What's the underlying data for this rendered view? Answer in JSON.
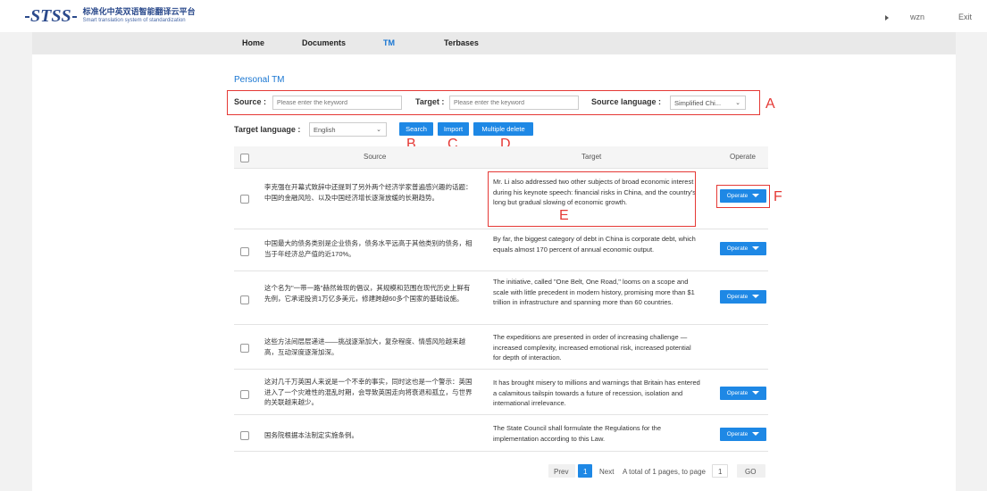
{
  "header": {
    "logo_mark": "STSS",
    "logo_cn": "标准化中英双语智能翻译云平台",
    "logo_en": "Smart translation system of standardization",
    "user": "wzn",
    "exit": "Exit"
  },
  "nav": {
    "items": [
      "Home",
      "Documents",
      "TM",
      "Terbases"
    ],
    "active": "TM"
  },
  "page_title": "Personal TM",
  "search": {
    "source_label": "Source :",
    "source_placeholder": "Please enter the keyword",
    "target_label": "Target :",
    "target_placeholder": "Please enter the keyword",
    "source_language_label": "Source language :",
    "source_language_value": "Simplified Chi...",
    "target_language_label": "Target language :",
    "target_language_value": "English"
  },
  "buttons": {
    "search": "Search",
    "import": "Import",
    "multiple_delete": "Multiple delete"
  },
  "annotations": {
    "a": "A",
    "b": "B",
    "c": "C",
    "d": "D",
    "e": "E",
    "f": "F"
  },
  "table": {
    "headers": {
      "source": "Source",
      "target": "Target",
      "operate": "Operate"
    },
    "operate_label": "Operate",
    "rows": [
      {
        "source": "李克强在开幕式致辞中还提到了另外两个经济学家普遍感兴趣的话题：中国的金融风险、以及中国经济增长逐渐放缓的长期趋势。",
        "target": "Mr. Li also addressed two other subjects of broad economic interest during his keynote speech: financial risks in China, and the country's long but gradual slowing of economic growth."
      },
      {
        "source": "中国最大的债务类别是企业债务，债务水平远高于其他类别的债务，相当于年经济总产值的近170%。",
        "target": "By far, the biggest category of debt in China is corporate debt, which equals almost 170 percent of annual economic output."
      },
      {
        "source": "这个名为\"一带一路\"赫然耸现的倡议，其规模和范围在现代历史上鲜有先例，它承诺投资1万亿多美元，修建跨越60多个国家的基础设施。",
        "target": "The initiative, called \"One Belt, One Road,\" looms on a scope and scale with little precedent in modern history, promising more than $1 trillion in infrastructure and spanning more than 60 countries."
      },
      {
        "source": "这些方法间层层递进——挑战逐渐加大，复杂程度、情感风险越来越高，互动深度逐渐加深。",
        "target": "The expeditions are presented in order of increasing challenge — increased complexity, increased emotional risk, increased potential for depth of interaction."
      },
      {
        "source": "这对几千万英国人来说是一个不幸的事实，同时这也是一个警示：英国进入了一个灾难性的混乱时期，会导致英国走向将衰退和孤立，与世界的关联越来越少。",
        "target": "It has brought misery to millions and warnings that Britain has entered a calamitous tailspin towards a future of recession, isolation and international irrelevance."
      },
      {
        "source": "国务院根据本法制定实施条例。",
        "target": "The State Council shall formulate the Regulations for the implementation according to this Law."
      }
    ]
  },
  "pagination": {
    "prev": "Prev",
    "current": "1",
    "next": "Next",
    "summary": "A total of 1 pages, to page",
    "page_input": "1",
    "go": "GO"
  }
}
